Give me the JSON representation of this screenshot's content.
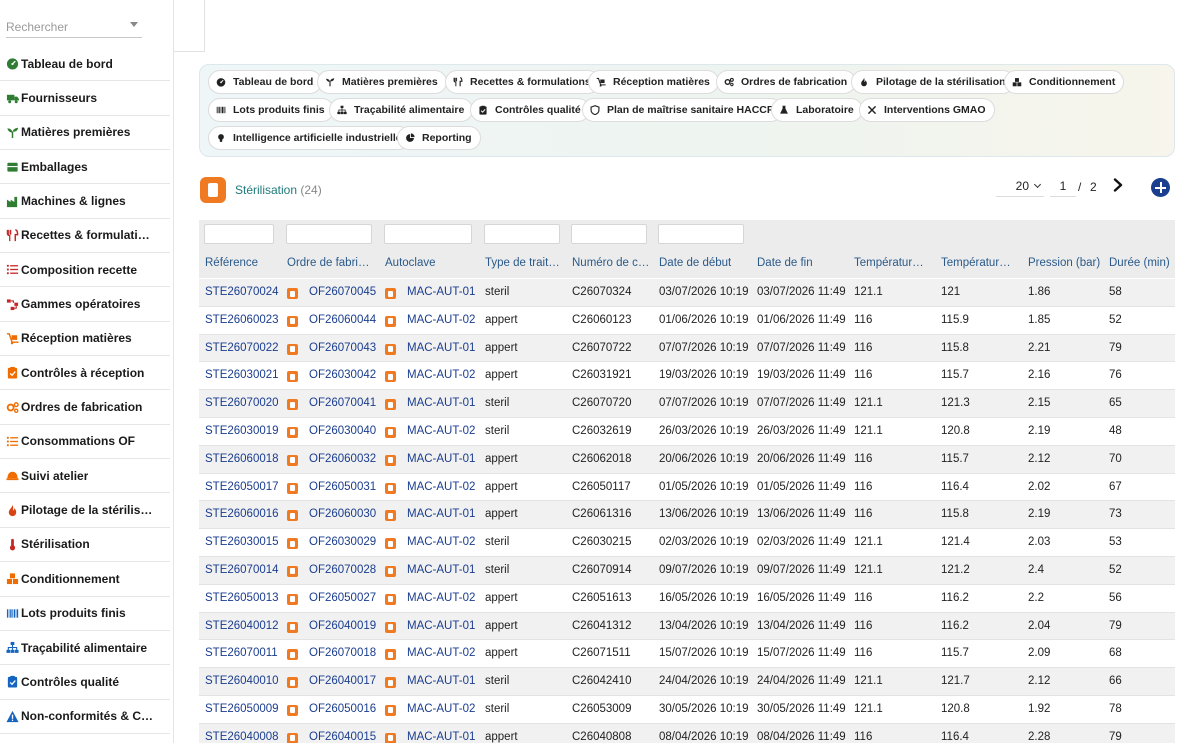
{
  "search": {
    "placeholder": "Rechercher"
  },
  "sidebar": {
    "items": [
      {
        "label": "Tableau de bord",
        "icon": "dashboard-icon"
      },
      {
        "label": "Fournisseurs",
        "icon": "truck-icon"
      },
      {
        "label": "Matières premières",
        "icon": "plant-icon"
      },
      {
        "label": "Emballages",
        "icon": "box-icon"
      },
      {
        "label": "Machines & lignes",
        "icon": "factory-icon"
      },
      {
        "label": "Recettes & formulati…",
        "icon": "utensils-icon"
      },
      {
        "label": "Composition recette",
        "icon": "list-icon"
      },
      {
        "label": "Gammes opératoires",
        "icon": "flow-icon"
      },
      {
        "label": "Réception matières",
        "icon": "dolly-icon"
      },
      {
        "label": "Contrôles à réception",
        "icon": "clipboard-check-icon"
      },
      {
        "label": "Ordres de fabrication",
        "icon": "gears-icon"
      },
      {
        "label": "Consommations OF",
        "icon": "list-icon"
      },
      {
        "label": "Suivi atelier",
        "icon": "helmet-icon"
      },
      {
        "label": "Pilotage de la stérilis…",
        "icon": "flame-icon"
      },
      {
        "label": "Stérilisation",
        "icon": "thermometer-icon"
      },
      {
        "label": "Conditionnement",
        "icon": "boxes-icon"
      },
      {
        "label": "Lots produits finis",
        "icon": "barcode-icon"
      },
      {
        "label": "Traçabilité alimentaire",
        "icon": "sitemap-icon"
      },
      {
        "label": "Contrôles qualité",
        "icon": "clipboard-check-icon"
      },
      {
        "label": "Non-conformités & C…",
        "icon": "warning-icon"
      }
    ]
  },
  "modules": {
    "chips": [
      {
        "label": "Tableau de bord",
        "icon": "dashboard-icon"
      },
      {
        "label": "Matières premières",
        "icon": "plant-icon"
      },
      {
        "label": "Recettes & formulations",
        "icon": "utensils-icon"
      },
      {
        "label": "Réception matières",
        "icon": "dolly-icon"
      },
      {
        "label": "Ordres de fabrication",
        "icon": "gears-icon"
      },
      {
        "label": "Pilotage de la stérilisation",
        "icon": "flame-icon"
      },
      {
        "label": "Conditionnement",
        "icon": "boxes-icon"
      },
      {
        "label": "Lots produits finis",
        "icon": "barcode-icon"
      },
      {
        "label": "Traçabilité alimentaire",
        "icon": "sitemap-icon"
      },
      {
        "label": "Contrôles qualité",
        "icon": "clipboard-check-icon"
      },
      {
        "label": "Plan de maîtrise sanitaire HACCP",
        "icon": "shield-icon"
      },
      {
        "label": "Laboratoire",
        "icon": "flask-icon"
      },
      {
        "label": "Interventions GMAO",
        "icon": "tools-icon"
      },
      {
        "label": "Intelligence artificielle industrielle",
        "icon": "lightbulb-icon"
      },
      {
        "label": "Reporting",
        "icon": "pie-chart-icon"
      }
    ]
  },
  "page": {
    "title": "Stérilisation",
    "count": "(24)"
  },
  "pager": {
    "page_size": "20",
    "current_page": "1",
    "separator": "/",
    "total_pages": "2"
  },
  "table": {
    "columns": [
      "Référence",
      "Ordre de fabric…",
      "Autoclave",
      "Type de trait…",
      "Numéro de c…",
      "Date de début",
      "Date de fin",
      "Température…",
      "Température…",
      "Pression (bar)",
      "Durée (min)"
    ],
    "rows": [
      [
        "STE26070024",
        "OF26070045",
        "MAC-AUT-01",
        "steril",
        "C26070324",
        "03/07/2026 10:19",
        "03/07/2026 11:49",
        "121.1",
        "121",
        "1.86",
        "58"
      ],
      [
        "STE26060023",
        "OF26060044",
        "MAC-AUT-02",
        "appert",
        "C26060123",
        "01/06/2026 10:19",
        "01/06/2026 11:49",
        "116",
        "115.9",
        "1.85",
        "52"
      ],
      [
        "STE26070022",
        "OF26070043",
        "MAC-AUT-01",
        "appert",
        "C26070722",
        "07/07/2026 10:19",
        "07/07/2026 11:49",
        "116",
        "115.8",
        "2.21",
        "79"
      ],
      [
        "STE26030021",
        "OF26030042",
        "MAC-AUT-02",
        "appert",
        "C26031921",
        "19/03/2026 10:19",
        "19/03/2026 11:49",
        "116",
        "115.7",
        "2.16",
        "76"
      ],
      [
        "STE26070020",
        "OF26070041",
        "MAC-AUT-01",
        "steril",
        "C26070720",
        "07/07/2026 10:19",
        "07/07/2026 11:49",
        "121.1",
        "121.3",
        "2.15",
        "65"
      ],
      [
        "STE26030019",
        "OF26030040",
        "MAC-AUT-02",
        "steril",
        "C26032619",
        "26/03/2026 10:19",
        "26/03/2026 11:49",
        "121.1",
        "120.8",
        "2.19",
        "48"
      ],
      [
        "STE26060018",
        "OF26060032",
        "MAC-AUT-01",
        "appert",
        "C26062018",
        "20/06/2026 10:19",
        "20/06/2026 11:49",
        "116",
        "115.7",
        "2.12",
        "70"
      ],
      [
        "STE26050017",
        "OF26050031",
        "MAC-AUT-02",
        "appert",
        "C26050117",
        "01/05/2026 10:19",
        "01/05/2026 11:49",
        "116",
        "116.4",
        "2.02",
        "67"
      ],
      [
        "STE26060016",
        "OF26060030",
        "MAC-AUT-01",
        "appert",
        "C26061316",
        "13/06/2026 10:19",
        "13/06/2026 11:49",
        "116",
        "115.8",
        "2.19",
        "73"
      ],
      [
        "STE26030015",
        "OF26030029",
        "MAC-AUT-02",
        "steril",
        "C26030215",
        "02/03/2026 10:19",
        "02/03/2026 11:49",
        "121.1",
        "121.4",
        "2.03",
        "53"
      ],
      [
        "STE26070014",
        "OF26070028",
        "MAC-AUT-01",
        "steril",
        "C26070914",
        "09/07/2026 10:19",
        "09/07/2026 11:49",
        "121.1",
        "121.2",
        "2.4",
        "52"
      ],
      [
        "STE26050013",
        "OF26050027",
        "MAC-AUT-02",
        "appert",
        "C26051613",
        "16/05/2026 10:19",
        "16/05/2026 11:49",
        "116",
        "116.2",
        "2.2",
        "56"
      ],
      [
        "STE26040012",
        "OF26040019",
        "MAC-AUT-01",
        "appert",
        "C26041312",
        "13/04/2026 10:19",
        "13/04/2026 11:49",
        "116",
        "116.2",
        "2.04",
        "79"
      ],
      [
        "STE26070011",
        "OF26070018",
        "MAC-AUT-02",
        "appert",
        "C26071511",
        "15/07/2026 10:19",
        "15/07/2026 11:49",
        "116",
        "115.7",
        "2.09",
        "68"
      ],
      [
        "STE26040010",
        "OF26040017",
        "MAC-AUT-01",
        "steril",
        "C26042410",
        "24/04/2026 10:19",
        "24/04/2026 11:49",
        "121.1",
        "121.7",
        "2.12",
        "66"
      ],
      [
        "STE26050009",
        "OF26050016",
        "MAC-AUT-02",
        "steril",
        "C26053009",
        "30/05/2026 10:19",
        "30/05/2026 11:49",
        "121.1",
        "120.8",
        "1.92",
        "78"
      ],
      [
        "STE26040008",
        "OF26040015",
        "MAC-AUT-01",
        "appert",
        "C26040808",
        "08/04/2026 10:19",
        "08/04/2026 11:49",
        "116",
        "116.4",
        "2.28",
        "79"
      ]
    ]
  },
  "colors": {
    "accent": "#1a3d8f",
    "brand_orange": "#f07a22",
    "title_teal": "#1f7a7a"
  }
}
